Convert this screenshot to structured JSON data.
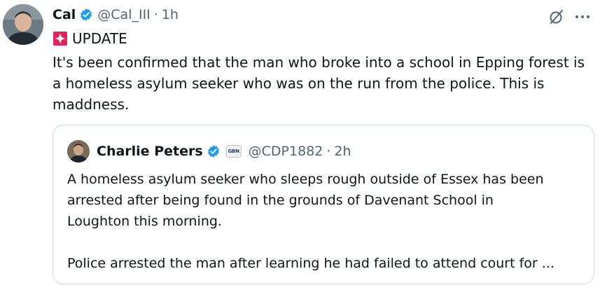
{
  "post": {
    "author_name": "Cal",
    "author_handle": "@Cal_III",
    "separator": "·",
    "time": "1h",
    "avatar_icon": "profile-photo",
    "verified_icon": "verified-badge-icon",
    "badge_color": "#1d9bf0",
    "update_label": "UPDATE",
    "update_icon": "siren-emoji-icon",
    "text_lines": [
      "It's been confirmed that the man who broke into a school in Epping forest is",
      "a homeless asylum seeker who was on the run from the police. This is",
      "maddness."
    ]
  },
  "actions": {
    "grok_icon": "grok-icon",
    "more_icon": "more-icon"
  },
  "quoted_post": {
    "author_name": "Charlie Peters",
    "affiliation_label": "GBN",
    "affiliation_icon": "gbnews-affiliate-badge",
    "author_handle": "@CDP1882",
    "separator": "·",
    "time": "2h",
    "paragraph1_lines": [
      "A homeless asylum seeker who sleeps rough outside of Essex has been",
      "arrested after being found in the grounds of Davenant School in",
      "Loughton this morning."
    ],
    "paragraph2_lines": [
      "Police arrested the man after learning he had failed to attend court for ..."
    ]
  },
  "colors": {
    "text": "#0f1419",
    "secondary_text": "#536471",
    "border": "#cfd9de",
    "verified_blue": "#1d9bf0"
  }
}
